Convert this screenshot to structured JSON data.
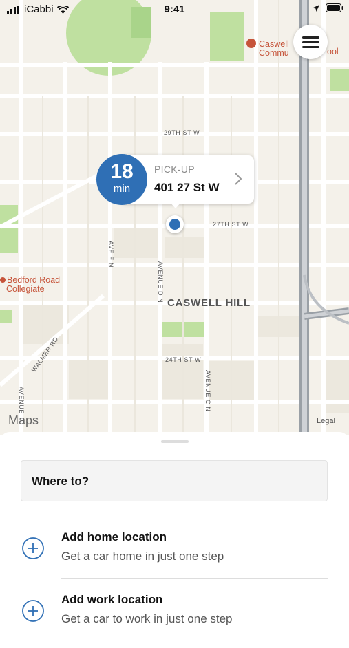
{
  "status_bar": {
    "carrier": "iCabbi",
    "time": "9:41"
  },
  "pickup": {
    "eta_value": "18",
    "eta_unit": "min",
    "label": "PICK-UP",
    "address": "401 27 St W"
  },
  "map": {
    "streets": [
      "29TH ST W",
      "27TH ST W",
      "24TH ST W",
      "AVE E N",
      "AVENUE D N",
      "AVENUE C N",
      "WALMER RD",
      "AVENUE"
    ],
    "district": "CASWELL HILL",
    "poi_bedford": [
      "Bedford Road",
      "Collegiate"
    ],
    "poi_caswell": [
      "Caswell",
      "Commu",
      "ool"
    ],
    "attribution": "Maps",
    "legal": "Legal"
  },
  "sheet": {
    "search_placeholder": "Where to?",
    "home": {
      "title": "Add home location",
      "subtitle": "Get a car home in just one step"
    },
    "work": {
      "title": "Add work location",
      "subtitle": "Get a car to work in just one step"
    }
  },
  "colors": {
    "accent": "#2f6fb5",
    "poi": "#c6543a",
    "park": "#bfe0a0"
  }
}
